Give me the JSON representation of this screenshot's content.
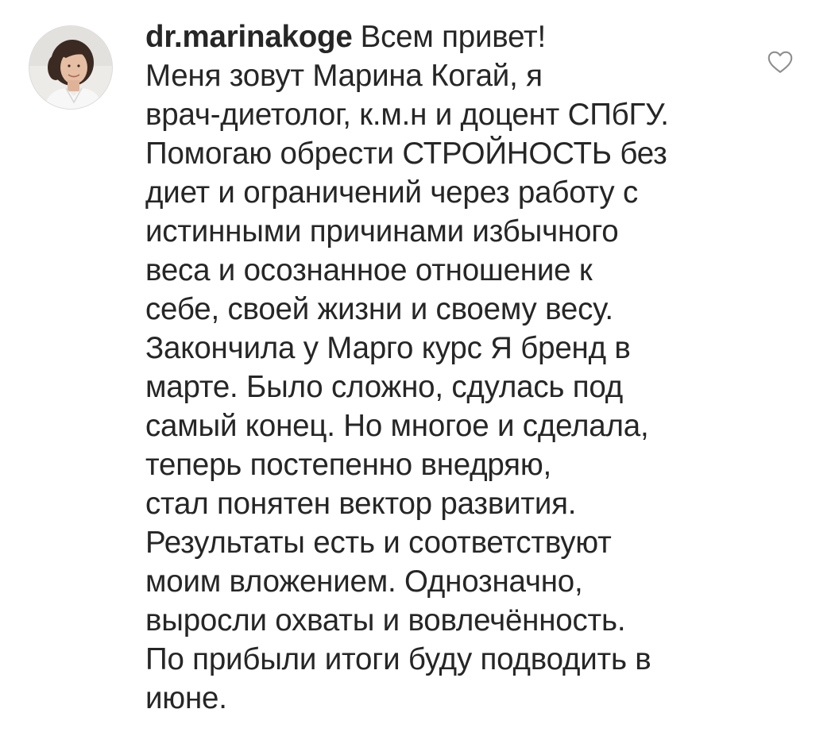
{
  "comment": {
    "username": "dr.marinakoge",
    "first_line_text": "Всем привет!",
    "lines": [
      "Меня зовут Марина Когай, я",
      "врач-диетолог, к.м.н и доцент СПбГУ.",
      "Помогаю обрести СТРОЙНОСТЬ без",
      "диет и ограничений через работу с",
      "истинными причинами избычного",
      "веса и осознанное отношение к",
      "себе, своей жизни и своему весу.",
      "Закончила у Марго курс Я бренд в",
      "марте. Было сложно, сдулась под",
      "самый конец. Но многое и сделала,",
      "теперь постепенно внедряю,",
      "стал понятен вектор развития.",
      "Результаты есть и соответствуют",
      "моим вложением. Однозначно,",
      "выросли охваты и вовлечённость.",
      "По прибыли итоги буду подводить в",
      "июне."
    ],
    "like_icon": "heart-outline-icon",
    "avatar_icon": "user-avatar-photo"
  },
  "colors": {
    "text": "#262626",
    "icon": "#8e8e8e",
    "background": "#ffffff"
  }
}
